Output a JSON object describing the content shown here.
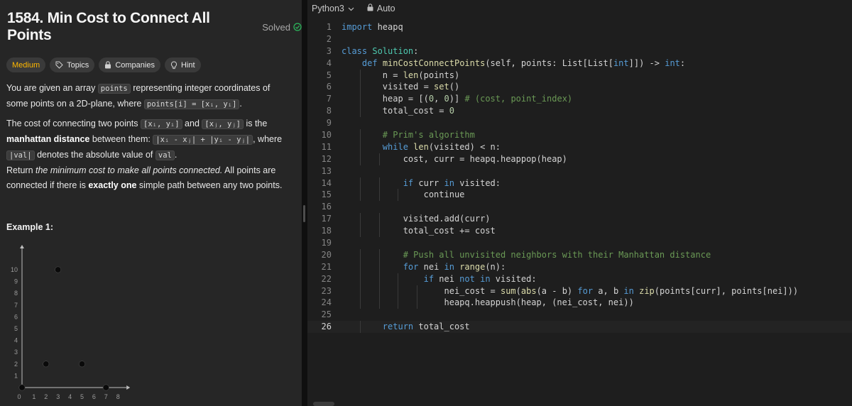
{
  "problem": {
    "title": "1584. Min Cost to Connect All Points",
    "status": "Solved",
    "tags": {
      "difficulty": "Medium",
      "topics": "Topics",
      "companies": "Companies",
      "hint": "Hint"
    },
    "description": {
      "p1_a": "You are given an array ",
      "p1_code1": "points",
      "p1_b": " representing integer coordinates of some points on a 2D-plane, where ",
      "p1_code2": "points[i] = [xᵢ, yᵢ]",
      "p1_c": ".",
      "p2_a": "The cost of connecting two points ",
      "p2_code1": "[xᵢ, yᵢ]",
      "p2_b": " and ",
      "p2_code2": "[xⱼ, yⱼ]",
      "p2_c": " is the ",
      "p2_bold": "manhattan distance",
      "p2_d": " between them: ",
      "p2_code3": "|xᵢ - xⱼ| + |yᵢ - yⱼ|",
      "p2_e": ", where ",
      "p2_code4": "|val|",
      "p2_f": " denotes the absolute value of ",
      "p2_code5": "val",
      "p2_g": ".",
      "p3_a": "Return ",
      "p3_italic": "the minimum cost to make all points connected.",
      "p3_b": " All points are connected if there is ",
      "p3_bold": "exactly one",
      "p3_c": " simple path between any two points."
    },
    "example_title": "Example 1:"
  },
  "chart_data": {
    "type": "scatter",
    "x_ticks": [
      "0",
      "1",
      "2",
      "3",
      "4",
      "5",
      "6",
      "7",
      "8"
    ],
    "y_ticks": [
      "1",
      "2",
      "3",
      "4",
      "5",
      "6",
      "7",
      "8",
      "9",
      "10"
    ],
    "xlim": [
      0,
      8
    ],
    "ylim": [
      0,
      10
    ],
    "points": [
      {
        "x": 0,
        "y": 0
      },
      {
        "x": 2,
        "y": 2
      },
      {
        "x": 3,
        "y": 10
      },
      {
        "x": 5,
        "y": 2
      },
      {
        "x": 7,
        "y": 0
      }
    ]
  },
  "editor": {
    "language": "Python3",
    "mode": "Auto",
    "current_line": 26,
    "lines": [
      "import heapq",
      "",
      "class Solution:",
      "    def minCostConnectPoints(self, points: List[List[int]]) -> int:",
      "        n = len(points)",
      "        visited = set()",
      "        heap = [(0, 0)] # (cost, point_index)",
      "        total_cost = 0",
      "",
      "        # Prim's algorithm",
      "        while len(visited) < n:",
      "            cost, curr = heapq.heappop(heap)",
      "",
      "            if curr in visited:",
      "                continue",
      "",
      "            visited.add(curr)",
      "            total_cost += cost",
      "",
      "            # Push all unvisited neighbors with their Manhattan distance",
      "            for nei in range(n):",
      "                if nei not in visited:",
      "                    nei_cost = sum(abs(a - b) for a, b in zip(points[curr], points[nei]))",
      "                    heapq.heappush(heap, (nei_cost, nei))",
      "",
      "        return total_cost"
    ]
  },
  "colors": {
    "medium": "#ffb800",
    "solved": "#2cbb5d",
    "keyword": "#569cd6",
    "function": "#dcdcaa",
    "class": "#4ec9b0",
    "number": "#b5cea8",
    "comment": "#6a9955"
  }
}
